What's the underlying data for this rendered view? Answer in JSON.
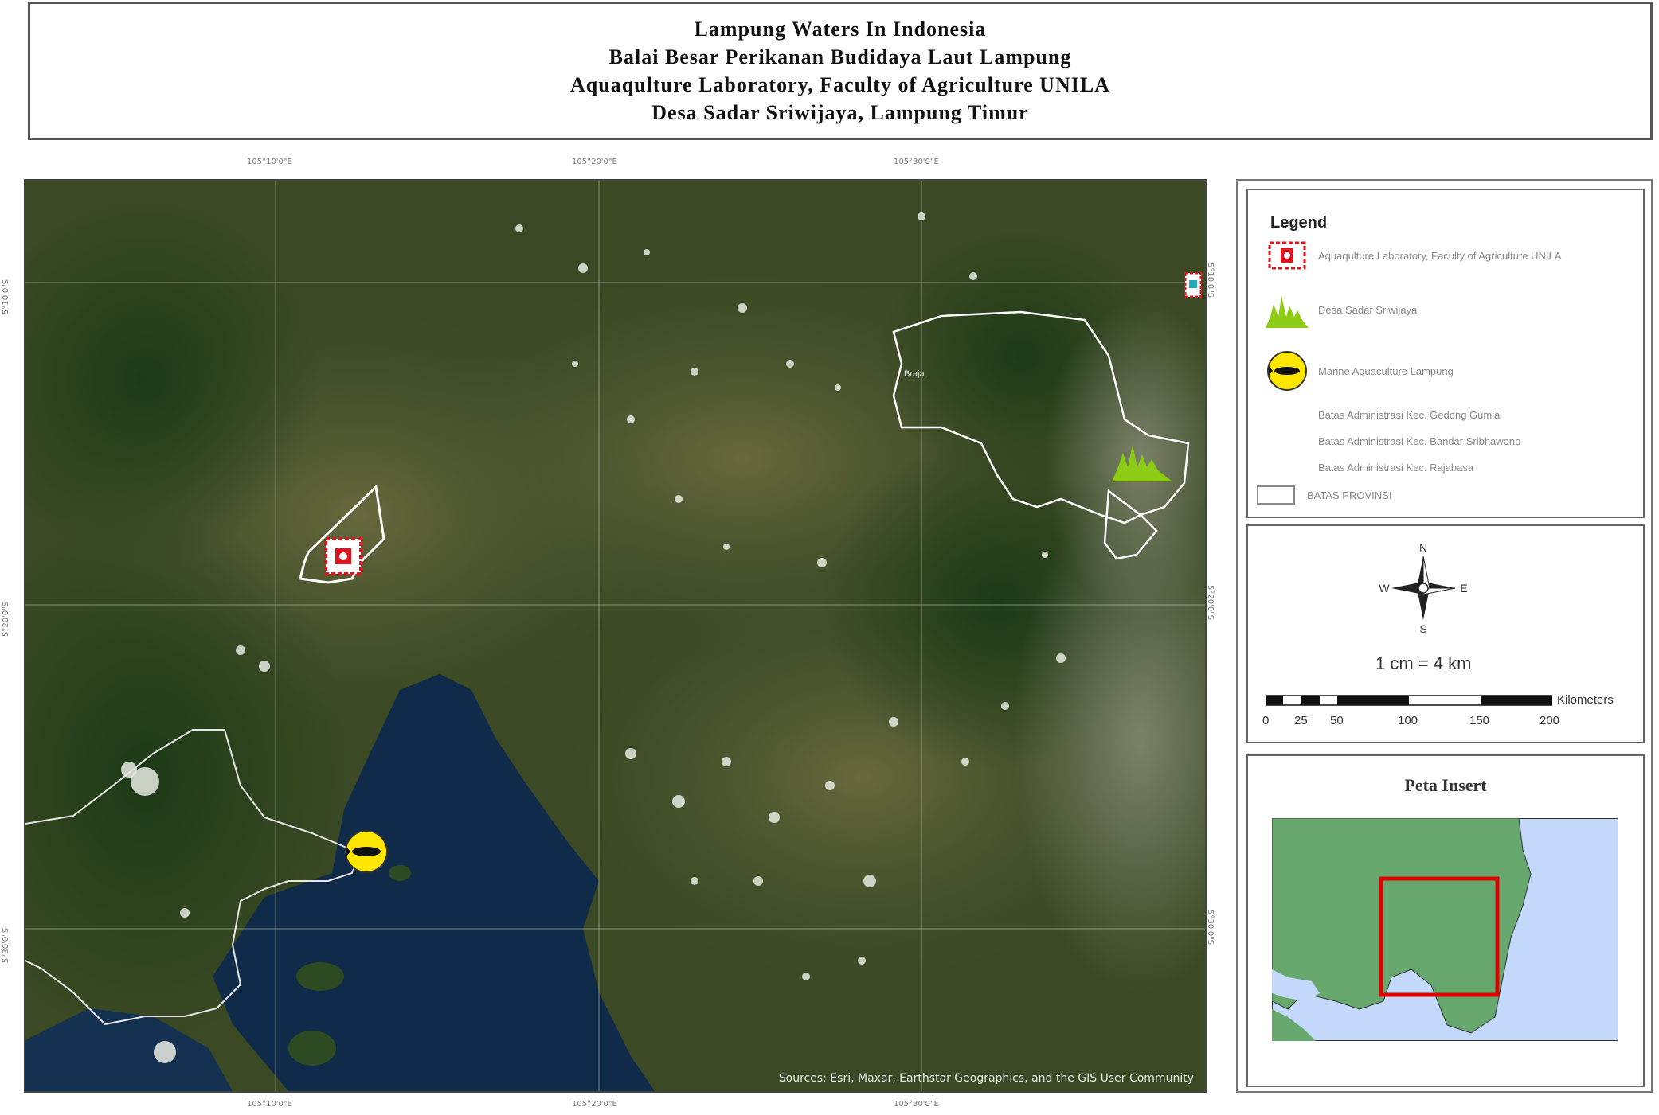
{
  "title": {
    "line1": "Lampung Waters In Indonesia",
    "line2": "Balai Besar Perikanan Budidaya Laut Lampung",
    "line3": "Aquaqulture Laboratory, Faculty of Agriculture UNILA",
    "line4": "Desa Sadar Sriwijaya, Lampung Timur"
  },
  "map": {
    "credit": "Sources: Esri, Maxar, Earthstar Geographics, and the GIS User Community",
    "place_label": "Braja",
    "ticks_top": [
      "105°10'0\"E",
      "105°20'0\"E",
      "105°30'0\"E"
    ],
    "ticks_bottom": [
      "105°10'0\"E",
      "105°20'0\"E",
      "105°30'0\"E"
    ],
    "ticks_left": [
      "5°10'0\"S",
      "5°20'0\"S",
      "5°30'0\"S"
    ],
    "ticks_right": [
      "5°10'0\"S",
      "5°20'0\"S",
      "5°30'0\"S"
    ],
    "colors": {
      "land_dark": "#2d4a1f",
      "land_brown": "#5b5a35",
      "sea": "#0f2a48",
      "boundary": "#ffffff",
      "lab_marker": "#e0141e",
      "village_marker": "#8ccc14",
      "marine_marker": "#ffe600"
    }
  },
  "legend": {
    "title": "Legend",
    "items": [
      {
        "label": "Aquaqulture Laboratory, Faculty of Agriculture UNILA",
        "icon": "lab-icon"
      },
      {
        "label": "Desa Sadar Sriwijaya",
        "icon": "village-icon"
      },
      {
        "label": "Marine Aquaculture Lampung",
        "icon": "marine-icon"
      },
      {
        "label": "Batas Administrasi Kec. Gedong Gumia",
        "icon": "none"
      },
      {
        "label": "Batas Administrasi Kec. Bandar Sribhawono",
        "icon": "none"
      },
      {
        "label": "Batas Administrasi Kec. Rajabasa",
        "icon": "none"
      },
      {
        "label": "BATAS PROVINSI",
        "icon": "boundary-swatch"
      }
    ]
  },
  "compass": {
    "n": "N",
    "s": "S",
    "e": "E",
    "w": "W"
  },
  "scale": {
    "ratio": "1 cm = 4 km",
    "unit": "Kilometers",
    "ticks": [
      "0",
      "25",
      "50",
      "100",
      "150",
      "200"
    ]
  },
  "inset": {
    "title": "Peta Insert",
    "colors": {
      "land": "#67a86f",
      "sea": "#c3d8fa",
      "frame": "#e00000"
    }
  }
}
